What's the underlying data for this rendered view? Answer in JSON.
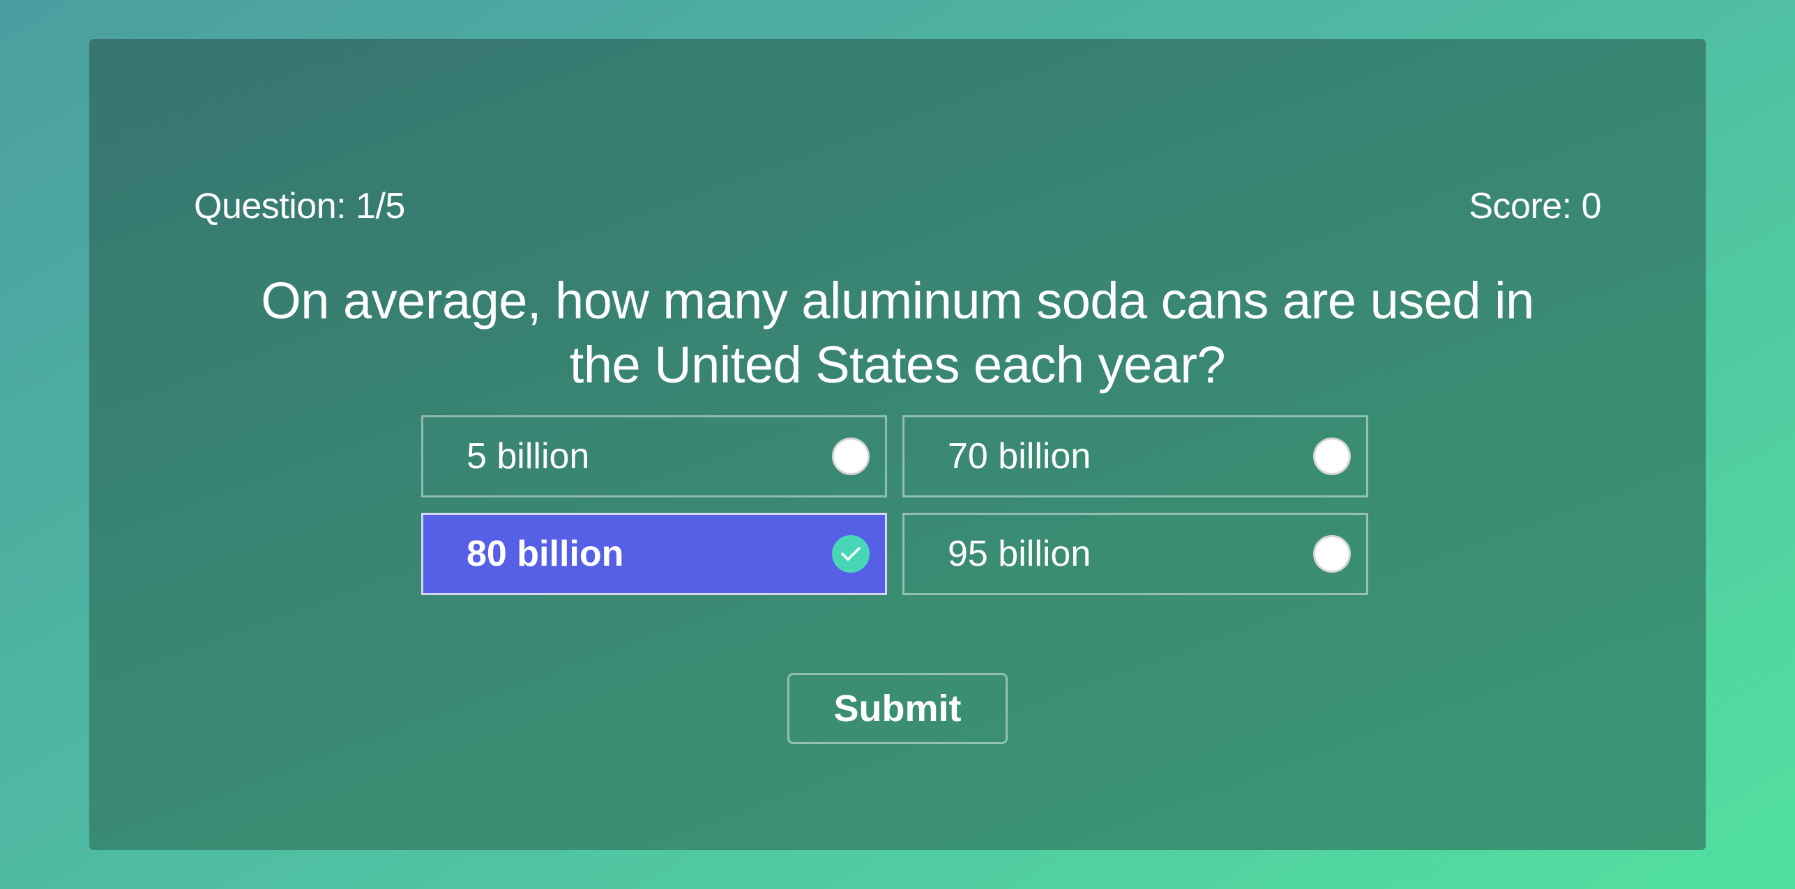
{
  "quiz": {
    "question_counter": "Question: 1/5",
    "score": "Score: 0",
    "question": "On average, how many aluminum soda cans are used in the United States each year?",
    "options": [
      {
        "label": "5 billion",
        "selected": false
      },
      {
        "label": "70 billion",
        "selected": false
      },
      {
        "label": "80 billion",
        "selected": true
      },
      {
        "label": "95 billion",
        "selected": false
      }
    ],
    "submit_label": "Submit"
  },
  "icons": {
    "radio_unchecked": "radio-unchecked-icon",
    "radio_checked": "checkmark-circle-icon"
  },
  "colors": {
    "selected_option": "#5560e6",
    "check_circle": "#48d6b6",
    "card": "#3a8a73"
  }
}
